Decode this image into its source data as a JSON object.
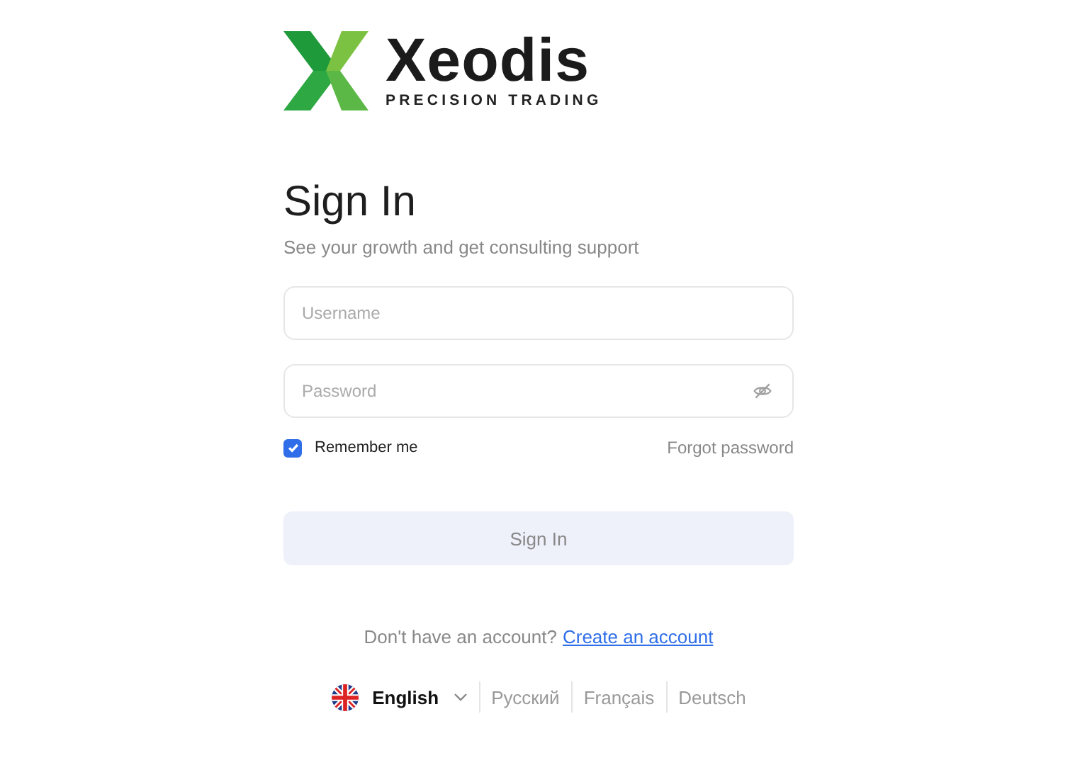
{
  "logo": {
    "name": "Xeodis",
    "tagline": "PRECISION TRADING"
  },
  "title": "Sign In",
  "subtitle": "See your growth and get consulting support",
  "fields": [
    {
      "kind": "text",
      "placeholder": "Username"
    },
    {
      "kind": "password",
      "placeholder": "Password"
    }
  ],
  "remember": {
    "label": "Remember me",
    "checked": true
  },
  "forgot_link": "Forgot password",
  "submit": {
    "label": "Sign In",
    "disabled": true
  },
  "signup": {
    "text": "Don't have an account?",
    "link": "Create an account"
  },
  "languages": [
    {
      "label": "English",
      "selected": true
    },
    {
      "label": "Русский",
      "selected": false
    },
    {
      "label": "Français",
      "selected": false
    },
    {
      "label": "Deutsch",
      "selected": false
    }
  ]
}
